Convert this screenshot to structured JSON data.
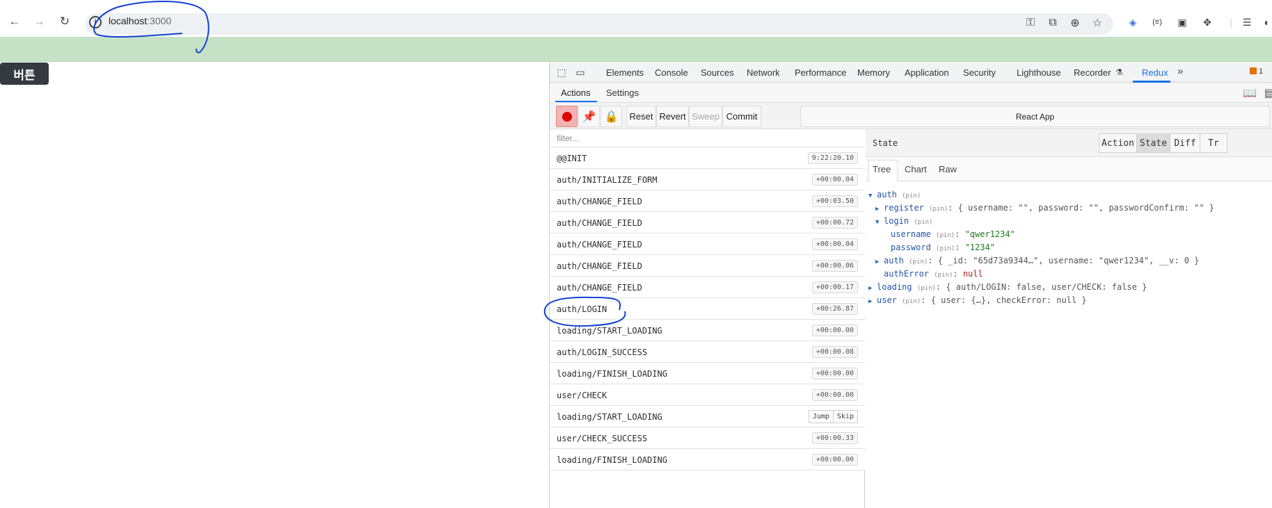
{
  "browser": {
    "url_host": "localhost",
    "url_port": ":3000",
    "icons": {
      "back": "back-arrow-icon",
      "forward": "forward-arrow-icon",
      "reload": "reload-icon",
      "site_info": "site-info-icon",
      "password": "key-icon",
      "open_external": "open-external-icon",
      "zoom": "zoom-icon",
      "bookmark": "star-icon",
      "extensions": "puzzle-icon"
    }
  },
  "page": {
    "button_label": "버튼"
  },
  "devtools": {
    "tabs": [
      "Elements",
      "Console",
      "Sources",
      "Network",
      "Performance",
      "Memory",
      "Application",
      "Security",
      "Lighthouse",
      "Recorder",
      "Redux"
    ],
    "active_tab": "Redux",
    "more": "»",
    "issues_count": "1",
    "subtabs": [
      "Actions",
      "Settings"
    ],
    "toolbar": {
      "reset": "Reset",
      "revert": "Revert",
      "sweep": "Sweep",
      "commit": "Commit",
      "instance": "React App"
    },
    "filter_placeholder": "filter...",
    "actions": [
      {
        "name": "@@INIT",
        "time": "9:22:20.10"
      },
      {
        "name": "auth/INITIALIZE_FORM",
        "time": "+00:00.04"
      },
      {
        "name": "auth/CHANGE_FIELD",
        "time": "+00:03.50"
      },
      {
        "name": "auth/CHANGE_FIELD",
        "time": "+00:00.72"
      },
      {
        "name": "auth/CHANGE_FIELD",
        "time": "+00:00.04"
      },
      {
        "name": "auth/CHANGE_FIELD",
        "time": "+00:00.06"
      },
      {
        "name": "auth/CHANGE_FIELD",
        "time": "+00:00.17"
      },
      {
        "name": "auth/LOGIN",
        "time": "+00:26.87"
      },
      {
        "name": "loading/START_LOADING",
        "time": "+00:00.00"
      },
      {
        "name": "auth/LOGIN_SUCCESS",
        "time": "+00:00.08"
      },
      {
        "name": "loading/FINISH_LOADING",
        "time": "+00:00.00"
      },
      {
        "name": "user/CHECK",
        "time": "+00:00.00"
      },
      {
        "name": "loading/START_LOADING",
        "jump": "Jump",
        "skip": "Skip"
      },
      {
        "name": "user/CHECK_SUCCESS",
        "time": "+00:00.33"
      },
      {
        "name": "loading/FINISH_LOADING",
        "time": "+00:00.00"
      }
    ],
    "state_panel": {
      "title": "State",
      "segments": [
        "Action",
        "State",
        "Diff",
        "Tr"
      ],
      "active_segment": "State",
      "view_tabs": [
        "Tree",
        "Chart",
        "Raw"
      ],
      "active_view": "Tree",
      "pin": "(pin)",
      "tree": {
        "auth": "auth",
        "register": "register",
        "register_summary": "{ username: \"\", password: \"\", passwordConfirm: \"\" }",
        "login": "login",
        "username_key": "username",
        "username_val": "\"qwer1234\"",
        "password_key": "password",
        "password_val": "\"1234\"",
        "auth_inner": "auth",
        "auth_inner_summary": "{ _id: \"65d73a9344…\", username: \"qwer1234\", __v: 0 }",
        "authError_key": "authError",
        "authError_val": "null",
        "loading": "loading",
        "loading_summary": "{ auth/LOGIN: false, user/CHECK: false }",
        "user": "user",
        "user_summary": "{ user: {…}, checkError: null }"
      }
    }
  }
}
